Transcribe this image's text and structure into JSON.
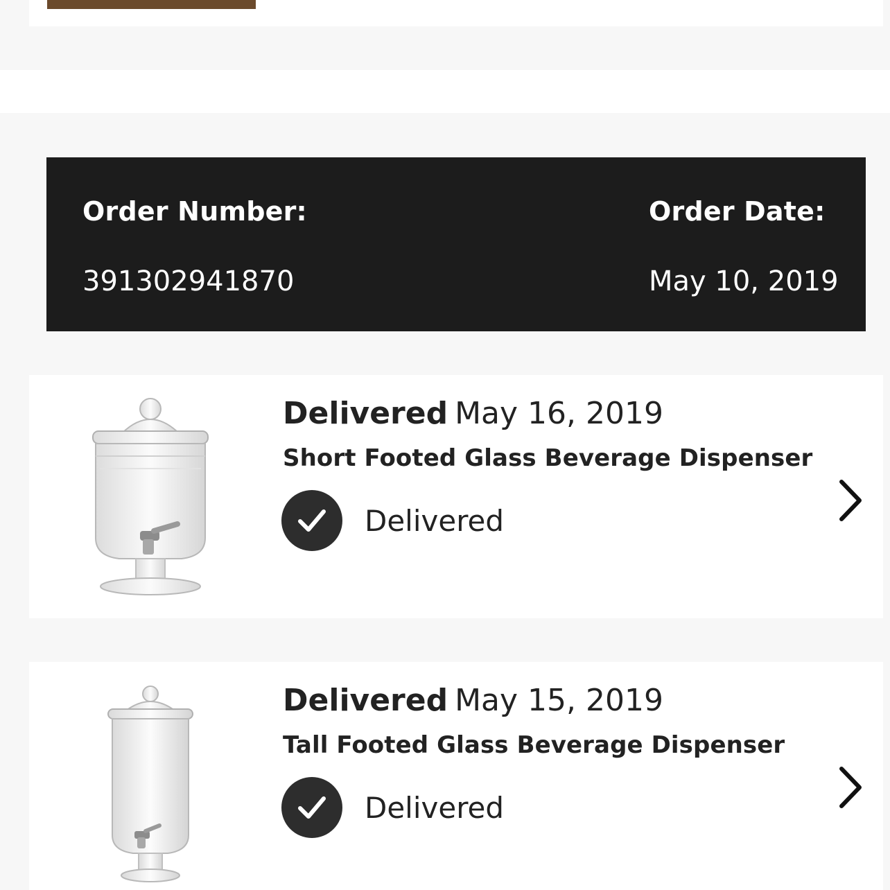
{
  "order": {
    "number_label": "Order Number:",
    "number_value": "391302941870",
    "date_label": "Order Date:",
    "date_value": "May 10, 2019"
  },
  "items": [
    {
      "status_heading": "Delivered",
      "delivery_date": "May 16, 2019",
      "name": "Short Footed Glass Beverage Dispenser",
      "status_label": "Delivered"
    },
    {
      "status_heading": "Delivered",
      "delivery_date": "May 15, 2019",
      "name": "Tall Footed Glass Beverage Dispenser",
      "status_label": "Delivered"
    }
  ],
  "icons": {
    "status": "check-circle-icon",
    "navigate": "chevron-right-icon"
  },
  "colors": {
    "header_bg": "#1c1c1c",
    "status_circle": "#2d2d2d",
    "page_bg": "#f7f7f7"
  }
}
